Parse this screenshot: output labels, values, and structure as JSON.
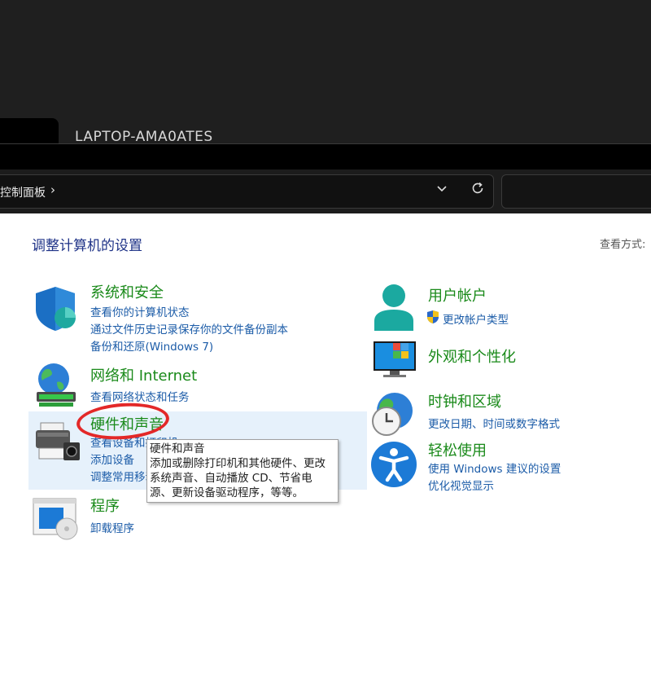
{
  "window": {
    "computer_name": "LAPTOP-AMA0ATES"
  },
  "address_bar": {
    "path": "控制面板",
    "separator": "›"
  },
  "page": {
    "title": "调整计算机的设置",
    "view_by": "查看方式:"
  },
  "categories_left": [
    {
      "title": "系统和安全",
      "links": [
        "查看你的计算机状态",
        "通过文件历史记录保存你的文件备份副本",
        "备份和还原(Windows 7)"
      ]
    },
    {
      "title": "网络和 Internet",
      "links": [
        "查看网络状态和任务"
      ]
    },
    {
      "title": "硬件和声音",
      "links": [
        "查看设备和打印机",
        "添加设备",
        "调整常用移动设置"
      ]
    },
    {
      "title": "程序",
      "links": [
        "卸载程序"
      ]
    }
  ],
  "categories_right": [
    {
      "title": "用户帐户",
      "links": [
        "更改帐户类型"
      ]
    },
    {
      "title": "外观和个性化",
      "links": []
    },
    {
      "title": "时钟和区域",
      "links": [
        "更改日期、时间或数字格式"
      ]
    },
    {
      "title": "轻松使用",
      "links": [
        "使用 Windows 建议的设置",
        "优化视觉显示"
      ]
    }
  ],
  "tooltip": {
    "title": "硬件和声音",
    "lines": [
      "添加或删除打印机和其他硬件、更改",
      "系统声音、自动播放 CD、节省电",
      "源、更新设备驱动程序，等等。"
    ]
  },
  "icons": {
    "system_security": "shield-icon",
    "network": "globe-network-icon",
    "hardware": "printer-icon",
    "programs": "programs-disc-icon",
    "user_accounts": "user-icon",
    "uac": "uac-shield-icon",
    "appearance": "monitor-icon",
    "clock_region": "clock-globe-icon",
    "ease_of_access": "accessibility-icon"
  },
  "colors": {
    "category_title": "#1a8a1a",
    "link": "#1c5ca8",
    "page_title": "#1e3287",
    "highlight": "#e6f1fb",
    "annotation": "#e32828"
  }
}
